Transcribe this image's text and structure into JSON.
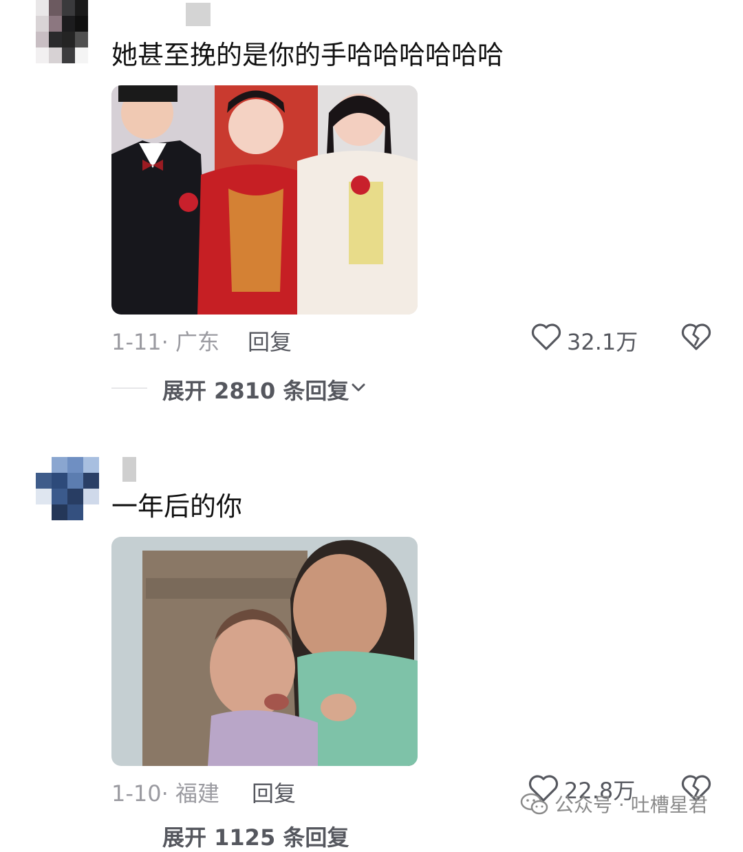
{
  "comments": [
    {
      "text": "她甚至挽的是你的手哈哈哈哈哈哈",
      "date_location": "1-11· 广东",
      "reply_label": "回复",
      "likes": "32.1万",
      "expand_label": "展开 2810 条回复"
    },
    {
      "text": "一年后的你",
      "date_location": "1-10· 福建",
      "reply_label": "回复",
      "likes": "22.8万",
      "expand_label": "展开 1125 条回复"
    }
  ],
  "watermark": {
    "text": "公众号 · 吐槽星君"
  },
  "icons": {
    "like": "heart-outline-icon",
    "dislike": "broken-heart-icon",
    "expand": "chevron-down-icon",
    "watermark": "wechat-icon"
  },
  "colors": {
    "text": "#111111",
    "meta": "#9a9aa0",
    "secondary": "#55575e"
  }
}
